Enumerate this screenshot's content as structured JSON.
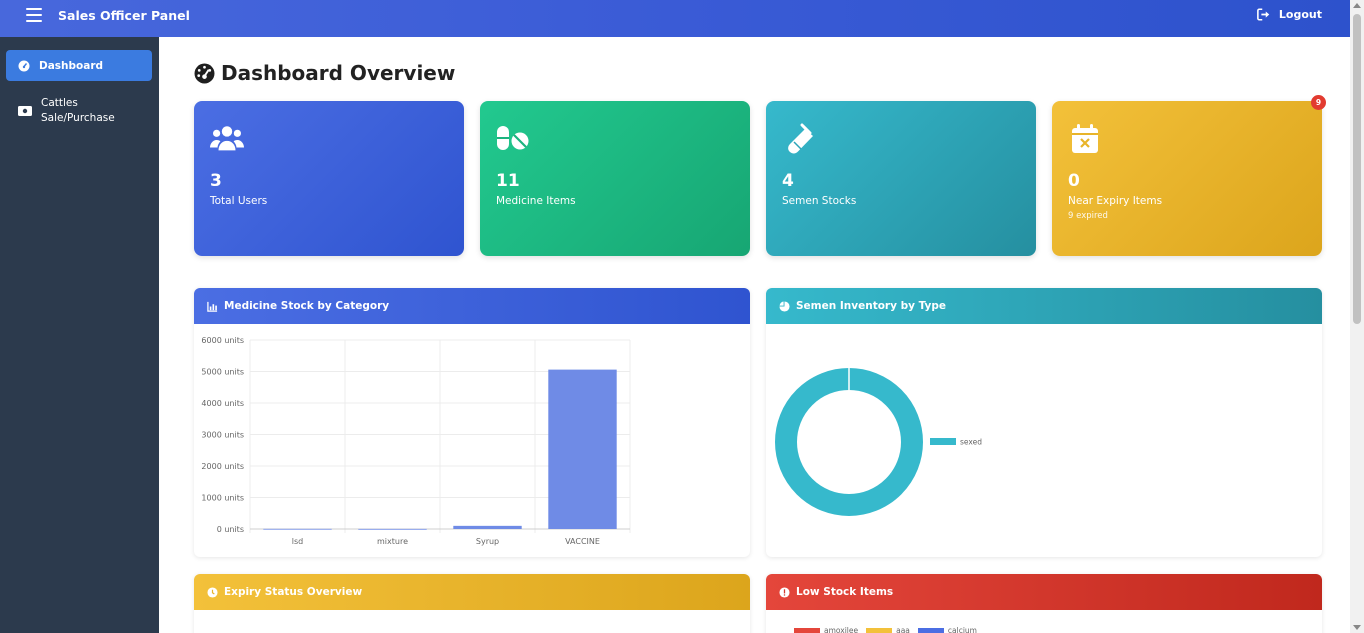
{
  "app": {
    "title": "Sales Officer Panel",
    "logout_label": "Logout"
  },
  "sidebar": {
    "items": [
      {
        "label": "Dashboard",
        "active": true,
        "icon": "gauge-icon"
      },
      {
        "label_line1": "Cattles",
        "label_line2": "Sale/Purchase",
        "active": false,
        "icon": "money-icon"
      }
    ]
  },
  "page": {
    "title": "Dashboard Overview",
    "title_icon": "gauge-icon"
  },
  "stats": [
    {
      "value": "3",
      "label": "Total Users",
      "icon": "users-icon",
      "color": "#3a5bd6"
    },
    {
      "value": "11",
      "label": "Medicine Items",
      "icon": "pills-icon",
      "color": "#1cb47f"
    },
    {
      "value": "4",
      "label": "Semen Stocks",
      "icon": "vial-icon",
      "color": "#2ea5b8"
    },
    {
      "value": "0",
      "label": "Near Expiry Items",
      "sub": "9 expired",
      "badge": "9",
      "icon": "calendar-x-icon",
      "color": "#e8b42a"
    }
  ],
  "panels": {
    "medicine": {
      "title": "Medicine Stock by Category",
      "icon": "bar-chart-icon"
    },
    "semen": {
      "title": "Semen Inventory by Type",
      "icon": "pie-chart-icon"
    },
    "expiry": {
      "title": "Expiry Status Overview",
      "icon": "clock-icon"
    },
    "lowstock": {
      "title": "Low Stock Items",
      "icon": "alert-icon"
    }
  },
  "chart_data": [
    {
      "type": "bar",
      "categories": [
        "lsd",
        "mixture",
        "Syrup",
        "VACCINE"
      ],
      "values": [
        5,
        3,
        100,
        5060
      ],
      "ylim": [
        0,
        6000
      ],
      "yticks": [
        {
          "value": 0,
          "label": "0 units"
        },
        {
          "value": 1000,
          "label": "1000 units"
        },
        {
          "value": 2000,
          "label": "2000 units"
        },
        {
          "value": 3000,
          "label": "3000 units"
        },
        {
          "value": 4000,
          "label": "4000 units"
        },
        {
          "value": 5000,
          "label": "5000 units"
        },
        {
          "value": 6000,
          "label": "6000 units"
        }
      ],
      "grid": true,
      "bar_color": "#6f8be6"
    },
    {
      "type": "pie",
      "labels": [
        "sexed"
      ],
      "values": [
        4
      ],
      "colors": [
        "#36b9cc"
      ],
      "legend": "right"
    },
    {
      "type": "bar",
      "legend_labels": [
        "amoxilee",
        "aaa",
        "calcium"
      ],
      "legend_colors": [
        "#e4463b",
        "#f3c13a",
        "#4b6ee3"
      ],
      "legend": "top"
    }
  ]
}
